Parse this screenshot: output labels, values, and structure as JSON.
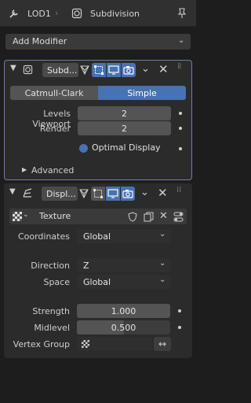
{
  "header": {
    "object_name": "LOD1",
    "modifier_name": "Subdivision"
  },
  "add_modifier": {
    "label": "Add Modifier"
  },
  "subdivision": {
    "name": "Subd...",
    "tabs": [
      "Catmull-Clark",
      "Simple"
    ],
    "active_tab": "Simple",
    "levels_viewport_label": "Levels Viewport",
    "levels_viewport_value": "2",
    "render_label": "Render",
    "render_value": "2",
    "optimal_display_label": "Optimal Display",
    "advanced_label": "Advanced"
  },
  "displace": {
    "name": "Displ...",
    "texture_label": "Texture",
    "coordinates_label": "Coordinates",
    "coordinates_value": "Global",
    "direction_label": "Direction",
    "direction_value": "Z",
    "space_label": "Space",
    "space_value": "Global",
    "strength_label": "Strength",
    "strength_value": "1.000",
    "midlevel_label": "Midlevel",
    "midlevel_value": "0.500",
    "vertex_group_label": "Vertex Group"
  },
  "colors": {
    "accent": "#4772b3",
    "panel": "#2b2b2b",
    "background": "#1d1d1d"
  }
}
